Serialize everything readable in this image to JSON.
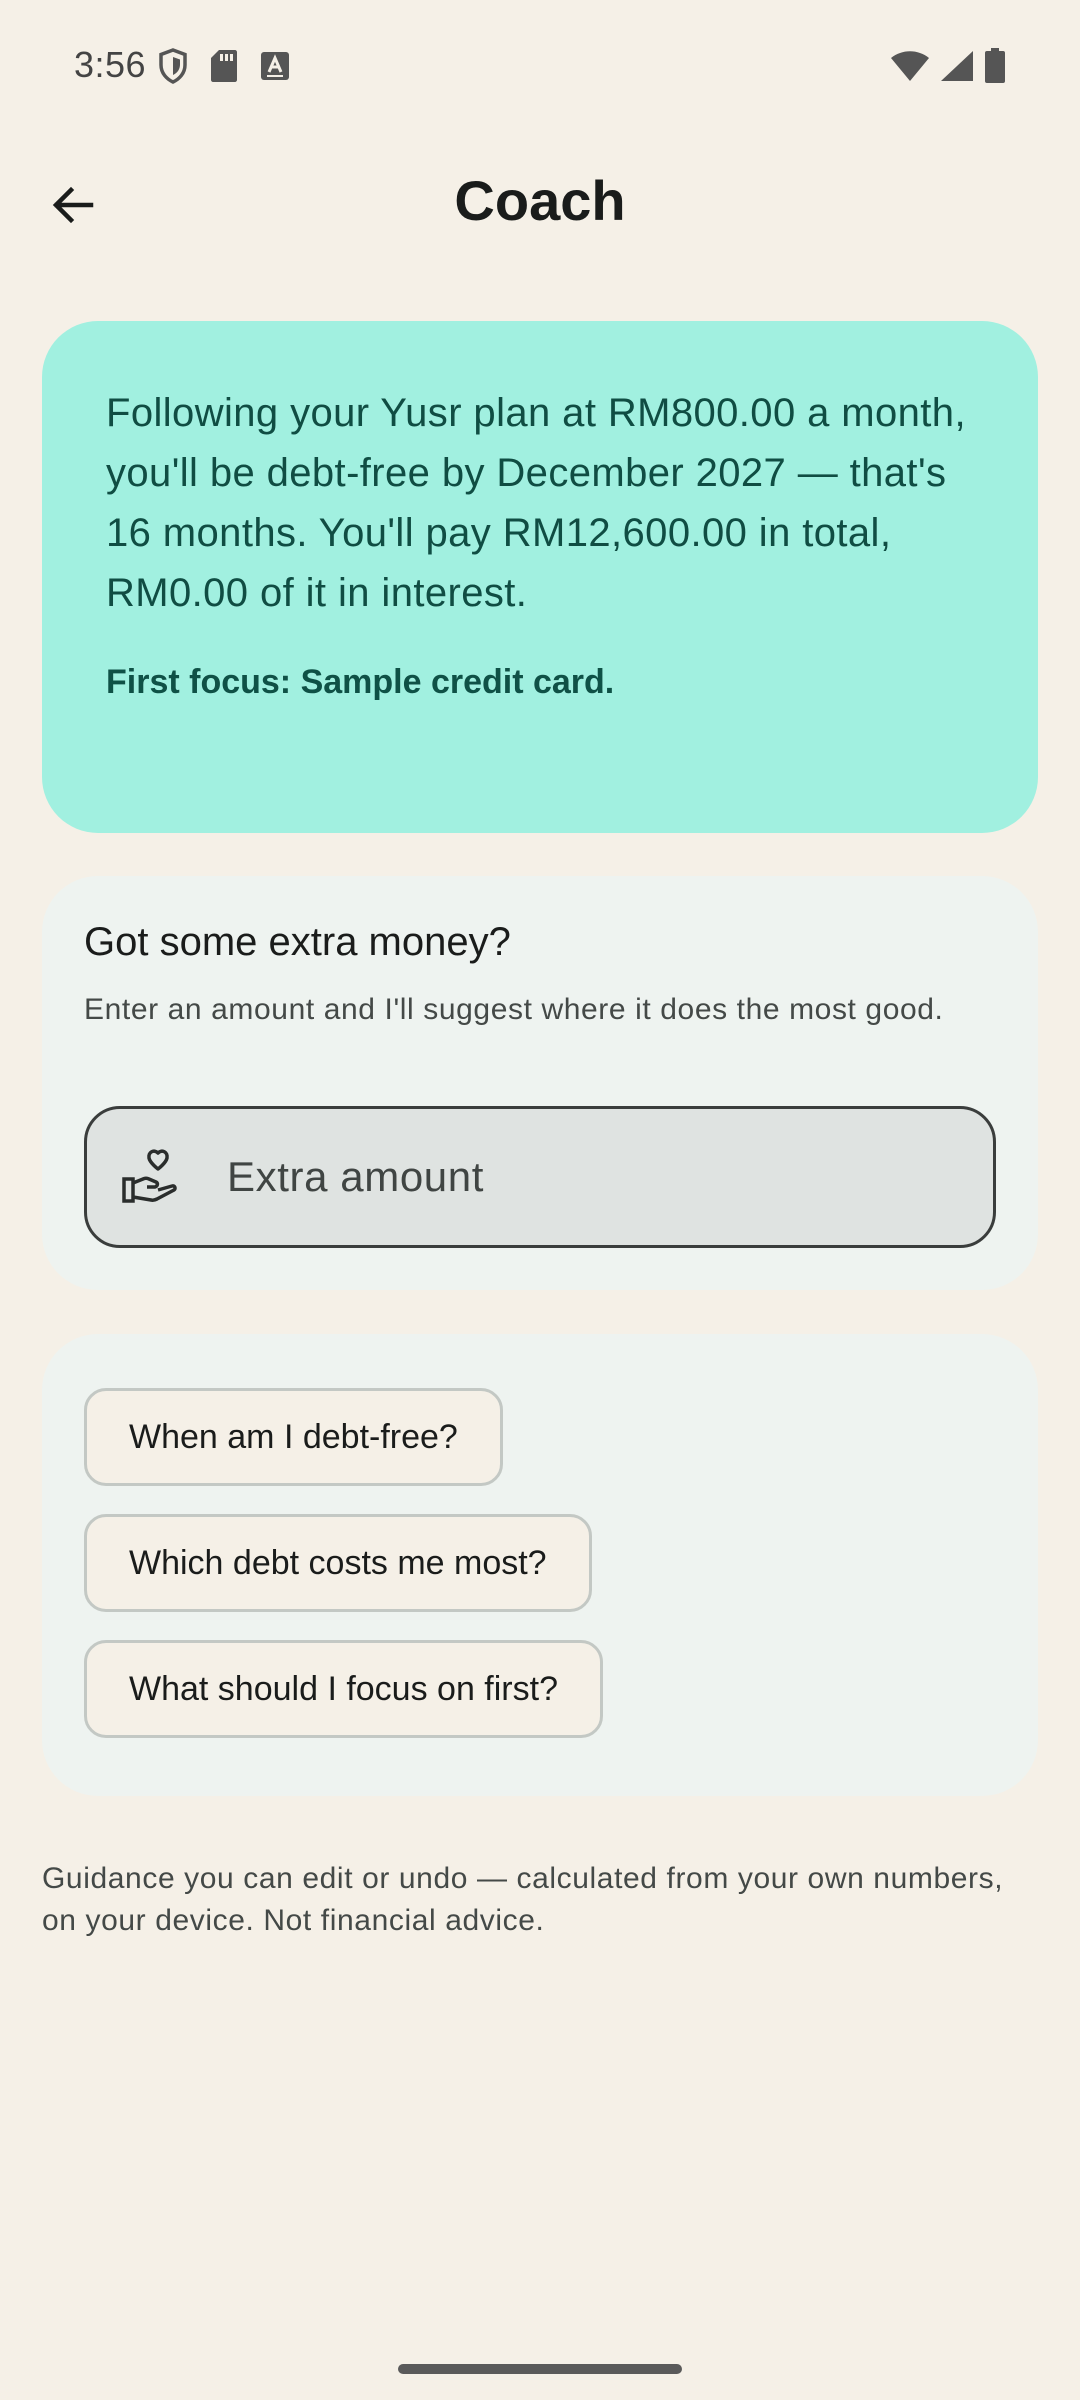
{
  "status_bar": {
    "time": "3:56",
    "left_icons": [
      "shield-icon",
      "sd-card-icon",
      "keyboard-icon"
    ],
    "right_icons": [
      "wifi-icon",
      "cell-signal-icon",
      "battery-icon"
    ]
  },
  "top_bar": {
    "back_icon": "arrow-back-icon",
    "title": "Coach"
  },
  "summary": {
    "text": "Following your Yusr plan at RM800.00 a month, you'll be debt-free by December 2027 — that's 16 months. You'll pay RM12,600.00 in total, RM0.00 of it in interest.",
    "focus": "First focus: Sample credit card."
  },
  "extra_money": {
    "title": "Got some extra money?",
    "subtitle": "Enter an amount and I'll suggest where it does the most good.",
    "input": {
      "icon": "hand-heart-icon",
      "placeholder": "Extra amount",
      "value": ""
    }
  },
  "questions": [
    {
      "label": "When am I debt-free?"
    },
    {
      "label": "Which debt costs me most?"
    },
    {
      "label": "What should I focus on first?"
    }
  ],
  "disclaimer": "Guidance you can edit or undo — calculated from your own numbers, on your device. Not financial advice.",
  "colors": {
    "background": "#f5f0e7",
    "summary_card": "#a1f0e0",
    "summary_text": "#104d43",
    "card": "#eef3f0",
    "input_fill": "#dfe3e1"
  }
}
